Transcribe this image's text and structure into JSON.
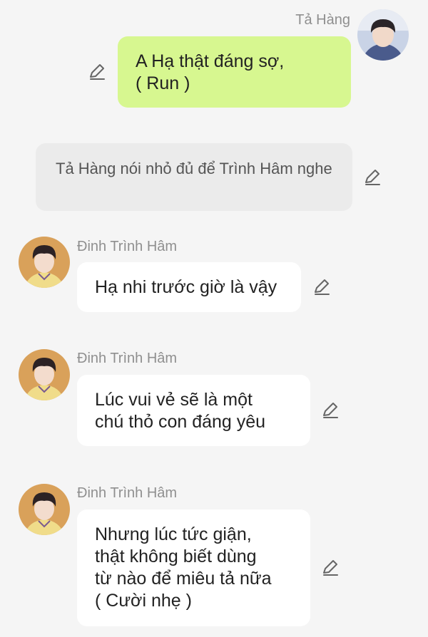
{
  "messages": [
    {
      "sender": "Tả Hàng",
      "avatar": "boy-blue-shirt-avatar",
      "text": "A Hạ thật đáng sợ,\n( Run )",
      "side": "right",
      "edit_icon": "pencil-icon"
    },
    {
      "type": "narration",
      "text": "Tả Hàng nói nhỏ đủ để Trình Hâm nghe",
      "edit_icon": "pencil-icon"
    },
    {
      "sender": "Đinh Trình Hâm",
      "avatar": "boy-yellow-jersey-avatar",
      "text": "Hạ nhi trước giờ là vậy",
      "side": "left",
      "edit_icon": "pencil-icon"
    },
    {
      "sender": "Đinh Trình Hâm",
      "avatar": "boy-yellow-jersey-avatar",
      "text": "Lúc vui vẻ sẽ là một\nchú thỏ con đáng yêu",
      "side": "left",
      "edit_icon": "pencil-icon"
    },
    {
      "sender": "Đinh Trình Hâm",
      "avatar": "boy-yellow-jersey-avatar",
      "text": "Nhưng lúc tức giận,\nthật không biết dùng\ntừ nào để miêu tả nữa\n( Cười nhẹ )",
      "side": "left",
      "edit_icon": "pencil-icon"
    }
  ],
  "colors": {
    "background": "#f5f5f5",
    "my_bubble": "#d7f790",
    "other_bubble": "#ffffff",
    "narration_bubble": "#ebebeb",
    "name_text": "#8f8f8f"
  }
}
